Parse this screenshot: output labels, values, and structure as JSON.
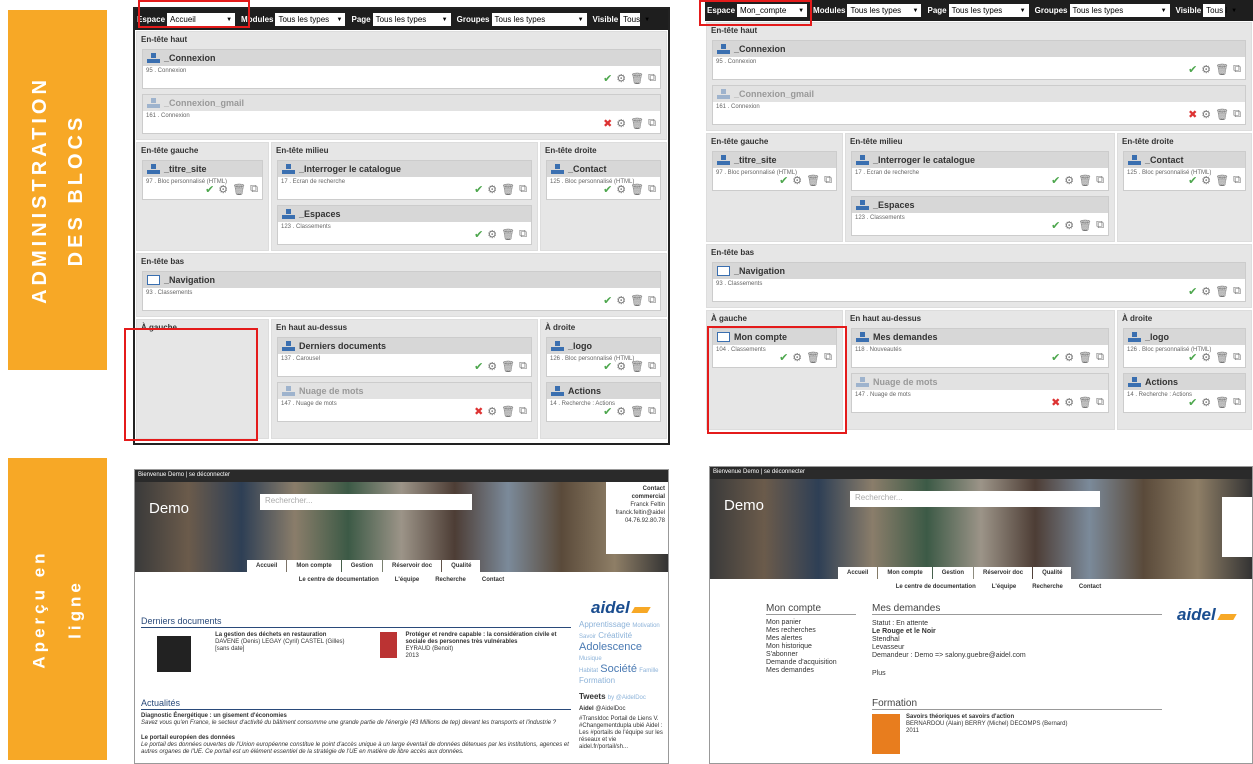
{
  "labels": {
    "admin": [
      "ADMINISTRATION",
      "DES BLOCS"
    ],
    "apercu": [
      "Aperçu en",
      "ligne"
    ]
  },
  "toolbar": {
    "espace": "Espace",
    "modules": "Modules",
    "page": "Page",
    "groupes": "Groupes",
    "visible": "Visible",
    "tous_types": "Tous les types",
    "sel_left": "Accueil",
    "sel_right": "Mon_compte",
    "vis_left": "Tous",
    "vis_right": "Tous l"
  },
  "sections": {
    "haut": "En-tête haut",
    "gauche": "En-tête gauche",
    "milieu": "En-tête milieu",
    "droite": "En-tête droite",
    "bas": "En-tête bas",
    "agauche": "À gauche",
    "haut_dessus": "En haut au-dessus",
    "adroite": "À droite"
  },
  "blocks": {
    "connexion": {
      "title": "_Connexion",
      "desc": "95 . Connexion"
    },
    "gmail": {
      "title": "_Connexion_gmail",
      "desc": "161 . Connexion"
    },
    "titre": {
      "title": "_titre_site",
      "desc": "97 . Bloc personnalisé (HTML)"
    },
    "interroger": {
      "title": "_Interroger le catalogue",
      "desc": "17 . Ecran de recherche"
    },
    "espaces": {
      "title": "_Espaces",
      "desc": "123 . Classements"
    },
    "contact": {
      "title": "_Contact",
      "desc": "125 . Bloc personnalisé (HTML)"
    },
    "navigation": {
      "title": "_Navigation",
      "desc": "93 . Classements"
    },
    "derniers": {
      "title": "Derniers documents",
      "desc": "137 . Carousel"
    },
    "nuage": {
      "title": "Nuage de mots",
      "desc": "147 . Nuage de mots"
    },
    "logo": {
      "title": "_logo",
      "desc": "126 . Bloc personnalisé (HTML)"
    },
    "actions": {
      "title": "Actions",
      "desc": "14 . Recherche : Actions"
    },
    "moncompte": {
      "title": "Mon compte",
      "desc": "104 . Classements"
    },
    "mesdemandes": {
      "title": "Mes demandes",
      "desc": "118 . Nouveautés"
    }
  },
  "site": {
    "welcome": "Bienvenue Demo | se déconnecter",
    "logo": "Demo",
    "search": "Rechercher...",
    "tabs": [
      "Accueil",
      "Mon compte",
      "Gestion",
      "Réservoir doc",
      "Qualité"
    ],
    "subnav": [
      "Le centre de documentation",
      "L'équipe",
      "Recherche",
      "Contact"
    ],
    "contact": [
      "Contact commercial",
      "Franck Feltin",
      "franck.feltin@aidel",
      "04.76.92.80.78"
    ],
    "brand": "aidel",
    "left": {
      "derniers": "Derniers documents",
      "doc1": "La gestion des déchets en restauration",
      "doc1b": "DAVENE (Denis) LEGAY (Cyril) CASTEL (Gilles)",
      "doc1c": "[sans date]",
      "doc2": "Protéger et rendre capable : la considération civile et sociale des personnes très vulnérables",
      "doc2b": "EYRAUD (Benoit)",
      "doc2c": "2013",
      "actu": "Actualités",
      "a1": "Diagnostic Énergétique : un gisement d'économies",
      "a1t": "Savez vous qu'en France, le secteur d'activité du bâtiment consomme une grande partie de l'énergie (43 Millions de tep) devant les transports et l'industrie ?",
      "a2": "Le portail européen des données",
      "a2t": "Le portail des données ouvertes de l'Union européenne constitue le point d'accès unique à un large éventail de données détenues par les institutions, agences et autres organes de l'UE. Ce portail est un élément essentiel de la stratégie de l'UE en matière de libre accès aux données.",
      "tags": [
        "Apprentissage",
        "Motivation",
        "Savoir",
        "Créativité",
        "Adolescence",
        "Musique",
        "Habitat",
        "Société",
        "Famille",
        "Formation"
      ],
      "tweets": "Tweets",
      "by": "by @AidelDoc",
      "tw_name": "Aidel",
      "tw_handle": "@AidelDoc",
      "tw_text": "#TransIdoc Portail de Liens V. #Changementdupla ubié Aidel : Les #portails de l'équipe sur les réseaux et vie aidel.fr/portail/sh..."
    },
    "right": {
      "moncompte": "Mon compte",
      "menu": [
        "Mon panier",
        "Mes recherches",
        "Mes alertes",
        "Mon historique",
        "S'abonner",
        "Demande d'acquisition",
        "Mes demandes"
      ],
      "mesdem": "Mes demandes",
      "statut": "Statut : En attente",
      "livre": "Le Rouge et le Noir",
      "auteur": "Stendhal",
      "editeur": "Levasseur",
      "demandeur": "Demandeur : Demo => salony.guebre@aidel.com",
      "plus": "Plus",
      "formation": "Formation",
      "f1": "Savoirs théoriques et savoirs d'action",
      "f1b": "BERNARDOU (Alain) BERRY (Michel) DECOMPS (Bernard)",
      "f1c": "2011"
    }
  }
}
